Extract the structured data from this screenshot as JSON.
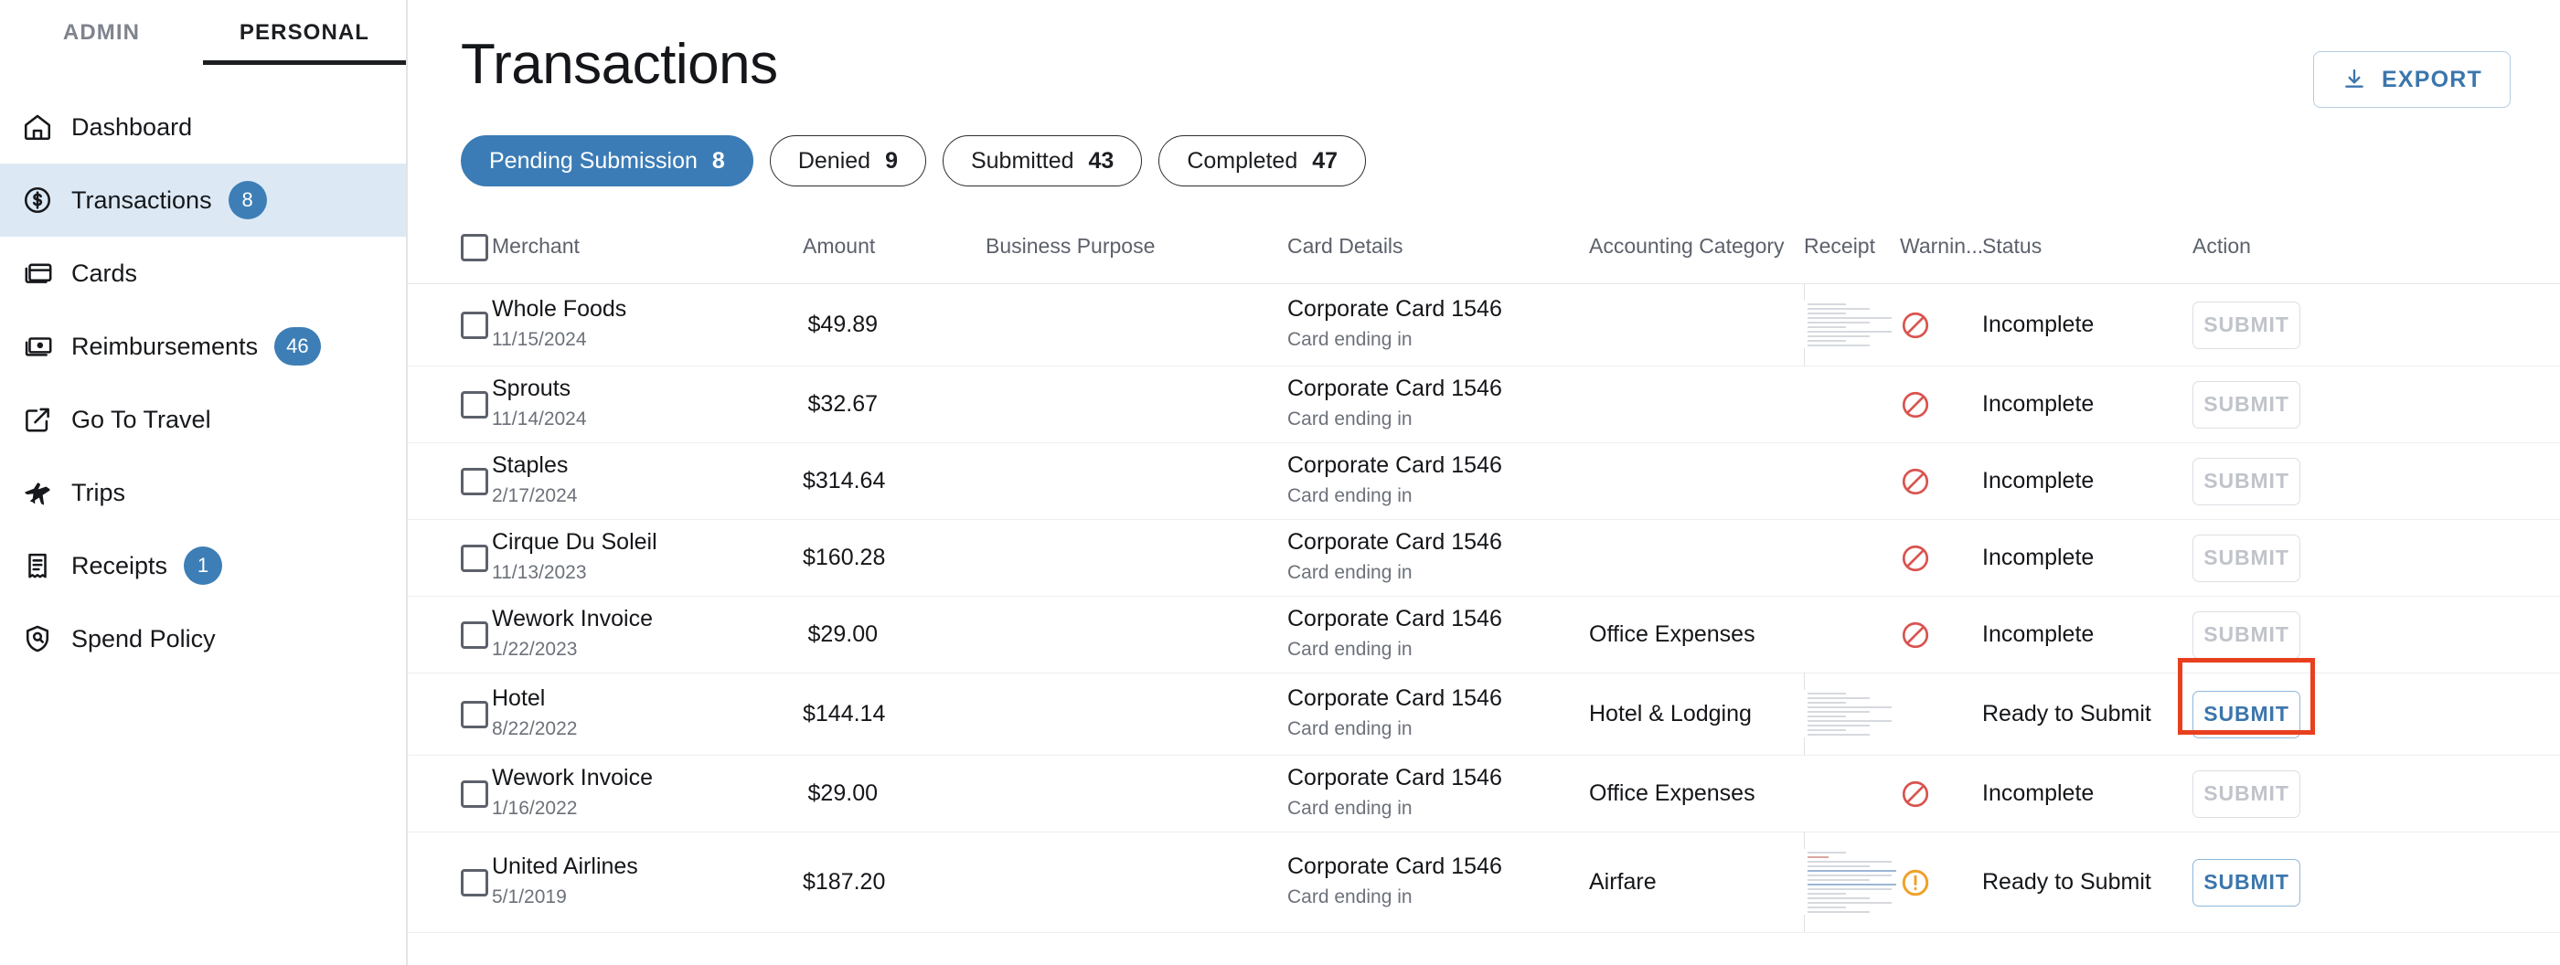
{
  "sidebar": {
    "tabs": [
      {
        "label": "ADMIN",
        "active": false
      },
      {
        "label": "PERSONAL",
        "active": true
      }
    ],
    "items": [
      {
        "label": "Dashboard",
        "icon": "home-icon",
        "badge": ""
      },
      {
        "label": "Transactions",
        "icon": "dollar-circle-icon",
        "badge": "8"
      },
      {
        "label": "Cards",
        "icon": "card-icon",
        "badge": ""
      },
      {
        "label": "Reimbursements",
        "icon": "cash-icon",
        "badge": "46"
      },
      {
        "label": "Go To Travel",
        "icon": "external-link-icon",
        "badge": ""
      },
      {
        "label": "Trips",
        "icon": "airplane-icon",
        "badge": ""
      },
      {
        "label": "Receipts",
        "icon": "receipt-icon",
        "badge": "1"
      },
      {
        "label": "Spend Policy",
        "icon": "shield-icon",
        "badge": ""
      }
    ]
  },
  "header": {
    "title": "Transactions",
    "export_label": "EXPORT",
    "export_icon": "download-icon"
  },
  "filters": [
    {
      "label": "Pending Submission",
      "count": "8",
      "active": true
    },
    {
      "label": "Denied",
      "count": "9",
      "active": false
    },
    {
      "label": "Submitted",
      "count": "43",
      "active": false
    },
    {
      "label": "Completed",
      "count": "47",
      "active": false
    }
  ],
  "table": {
    "columns": [
      "Merchant",
      "Amount",
      "Business Purpose",
      "Card Details",
      "Accounting Category",
      "Receipt",
      "Warnin...",
      "Status",
      "Action"
    ],
    "rows": [
      {
        "merchant": "Whole Foods",
        "date": "11/15/2024",
        "amount": "$49.89",
        "business_purpose": "",
        "card_name": "Corporate Card 1546",
        "card_sub": "Card ending in",
        "category": "",
        "receipt": "narrow",
        "warning": "deny",
        "status": "Incomplete",
        "action": "SUBMIT",
        "action_enabled": false,
        "highlighted": false
      },
      {
        "merchant": "Sprouts",
        "date": "11/14/2024",
        "amount": "$32.67",
        "business_purpose": "",
        "card_name": "Corporate Card 1546",
        "card_sub": "Card ending in",
        "category": "",
        "receipt": "none",
        "warning": "deny",
        "status": "Incomplete",
        "action": "SUBMIT",
        "action_enabled": false,
        "highlighted": false
      },
      {
        "merchant": "Staples",
        "date": "2/17/2024",
        "amount": "$314.64",
        "business_purpose": "",
        "card_name": "Corporate Card 1546",
        "card_sub": "Card ending in",
        "category": "",
        "receipt": "none",
        "warning": "deny",
        "status": "Incomplete",
        "action": "SUBMIT",
        "action_enabled": false,
        "highlighted": false
      },
      {
        "merchant": "Cirque Du Soleil",
        "date": "11/13/2023",
        "amount": "$160.28",
        "business_purpose": "",
        "card_name": "Corporate Card 1546",
        "card_sub": "Card ending in",
        "category": "",
        "receipt": "none",
        "warning": "deny",
        "status": "Incomplete",
        "action": "SUBMIT",
        "action_enabled": false,
        "highlighted": false
      },
      {
        "merchant": "Wework Invoice",
        "date": "1/22/2023",
        "amount": "$29.00",
        "business_purpose": "",
        "card_name": "Corporate Card 1546",
        "card_sub": "Card ending in",
        "category": "Office Expenses",
        "receipt": "none",
        "warning": "deny",
        "status": "Incomplete",
        "action": "SUBMIT",
        "action_enabled": false,
        "highlighted": false
      },
      {
        "merchant": "Hotel",
        "date": "8/22/2022",
        "amount": "$144.14",
        "business_purpose": "",
        "card_name": "Corporate Card 1546",
        "card_sub": "Card ending in",
        "category": "Hotel & Lodging",
        "receipt": "narrow",
        "warning": "none",
        "status": "Ready to Submit",
        "action": "SUBMIT",
        "action_enabled": true,
        "highlighted": true
      },
      {
        "merchant": "Wework Invoice",
        "date": "1/16/2022",
        "amount": "$29.00",
        "business_purpose": "",
        "card_name": "Corporate Card 1546",
        "card_sub": "Card ending in",
        "category": "Office Expenses",
        "receipt": "none",
        "warning": "deny",
        "status": "Incomplete",
        "action": "SUBMIT",
        "action_enabled": false,
        "highlighted": false
      },
      {
        "merchant": "United Airlines",
        "date": "5/1/2019",
        "amount": "$187.20",
        "business_purpose": "",
        "card_name": "Corporate Card 1546",
        "card_sub": "Card ending in",
        "category": "Airfare",
        "receipt": "wide",
        "warning": "exclamation",
        "status": "Ready to Submit",
        "action": "SUBMIT",
        "action_enabled": true,
        "highlighted": false
      }
    ]
  },
  "colors": {
    "accent_blue": "#3b7cb6",
    "active_nav_bg": "#dce9f5",
    "deny_red": "#d9534f",
    "warning_orange": "#f0a128",
    "highlight_red": "#e8401f",
    "link_blue": "#3b76ac"
  }
}
